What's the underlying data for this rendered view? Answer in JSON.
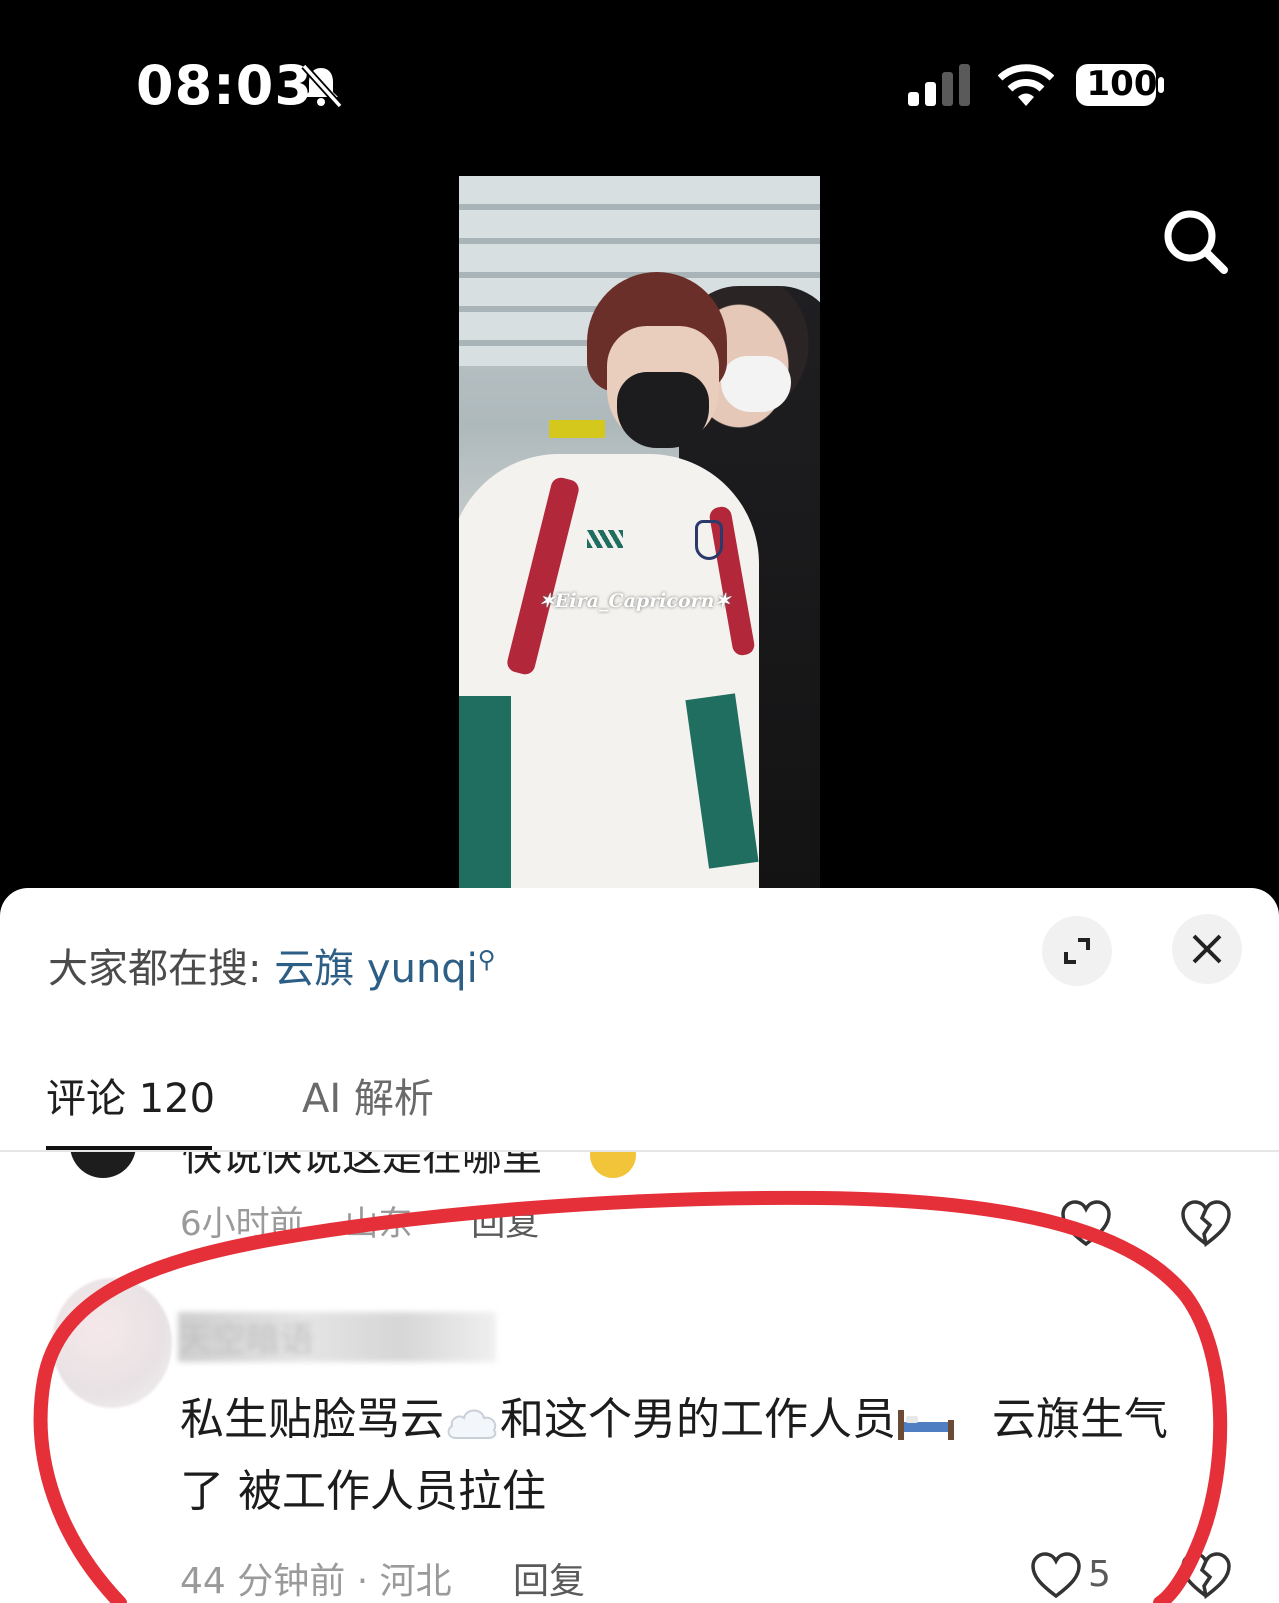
{
  "status_bar": {
    "time": "08:03",
    "battery": "100"
  },
  "video": {
    "watermark": "✶Eira_Capricorn✶"
  },
  "sheet": {
    "hot_search_label": "大家都在搜:",
    "hot_search_term": "云旗 yunqi",
    "tabs": [
      {
        "label": "评论 120"
      },
      {
        "label": "AI 解析"
      }
    ]
  },
  "comments": [
    {
      "text_partial": "快说快说这是在哪里",
      "time": "6小时前",
      "location": "山东",
      "reply_label": "回复"
    },
    {
      "username": "天空暗语",
      "line1_a": "私生贴脸骂云",
      "line1_b": "和这个男的工作人员",
      "line1_c": "云旗生气",
      "line2": "了 被工作人员拉住",
      "meta": "44 分钟前 · 河北",
      "reply_label": "回复",
      "likes": "5"
    }
  ],
  "colors": {
    "link": "#2d5f86",
    "annotation": "#e5303a"
  }
}
